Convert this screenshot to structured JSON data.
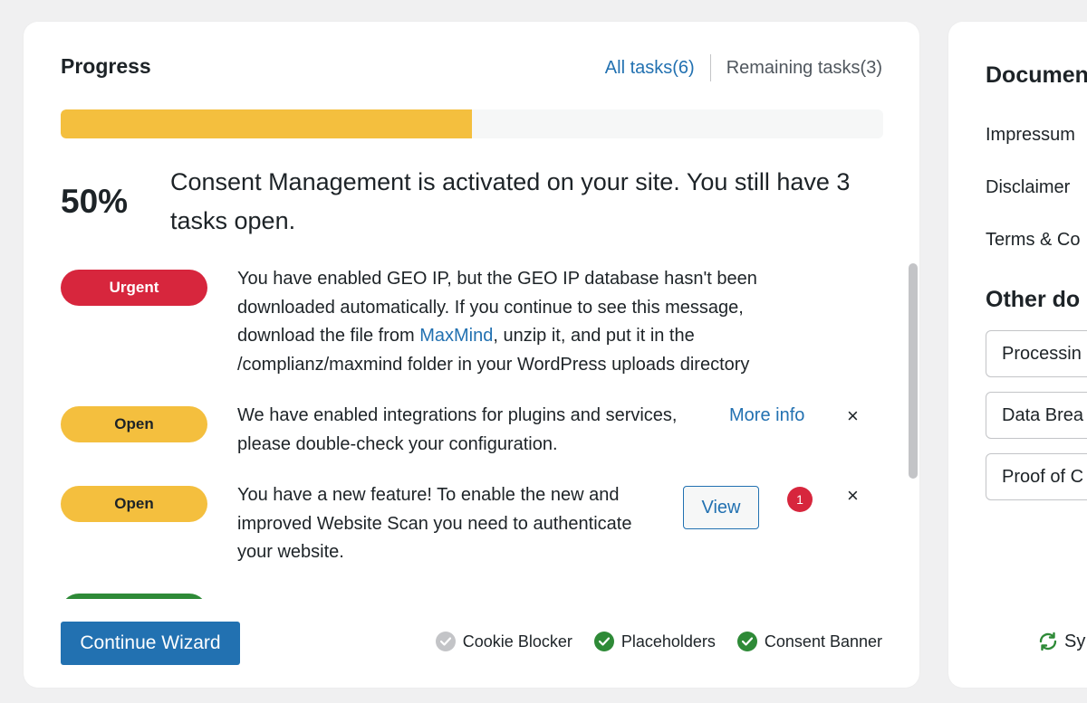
{
  "progress": {
    "title": "Progress",
    "tab_all": "All tasks(6)",
    "tab_remaining": "Remaining tasks(3)",
    "percent_value": 0.5,
    "percent_label": "50%",
    "headline": "Consent Management is activated on your site. You still have 3 tasks open.",
    "tasks": [
      {
        "status": "Urgent",
        "text_before": "You have enabled GEO IP, but the GEO IP database hasn't been downloaded automatically. If you continue to see this message, download the file from ",
        "link": "MaxMind",
        "text_after": ", unzip it, and put it in the /complianz/maxmind folder in your WordPress uploads directory"
      },
      {
        "status": "Open",
        "text": "We have enabled integrations for plugins and services, please double-check your configuration.",
        "action": "More info",
        "dismiss": "×"
      },
      {
        "status": "Open",
        "text": "You have a new feature! To enable the new and improved Website Scan you need to authenticate your website.",
        "action": "View",
        "notification_count": "1",
        "dismiss": "×"
      }
    ],
    "continue_button": "Continue Wizard",
    "statuses": [
      {
        "label": "Cookie Blocker",
        "state": "inactive"
      },
      {
        "label": "Placeholders",
        "state": "active"
      },
      {
        "label": "Consent Banner",
        "state": "active"
      }
    ]
  },
  "documents": {
    "title": "Documen",
    "items": [
      "Impressum",
      "Disclaimer",
      "Terms & Co"
    ],
    "other_title": "Other do",
    "other_items": [
      "Processin",
      "Data Brea",
      "Proof of C"
    ],
    "sync_label": "Sy"
  },
  "colors": {
    "accent": "#2271b1",
    "bar_fill": "#f4bf3e",
    "urgent": "#d7263d",
    "open": "#f4bf3e",
    "done": "#2e8a37",
    "inactive": "#c3c4c7"
  }
}
